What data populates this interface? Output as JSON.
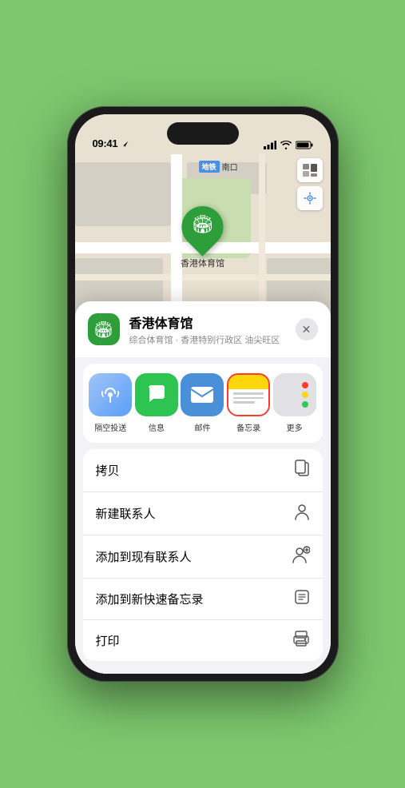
{
  "status_bar": {
    "time": "09:41",
    "location_arrow": true
  },
  "map": {
    "label_badge": "南口",
    "location_name": "香港体育馆",
    "pin_icon": "🏟"
  },
  "map_controls": {
    "map_icon": "🗺",
    "location_icon": "➤"
  },
  "location_card": {
    "name": "香港体育馆",
    "subtitle": "综合体育馆 · 香港特别行政区 油尖旺区",
    "close_label": "✕"
  },
  "share_items": [
    {
      "id": "airdrop",
      "label": "隔空投送",
      "type": "airdrop"
    },
    {
      "id": "messages",
      "label": "信息",
      "type": "messages"
    },
    {
      "id": "mail",
      "label": "邮件",
      "type": "mail"
    },
    {
      "id": "notes",
      "label": "备忘录",
      "type": "notes",
      "selected": true
    }
  ],
  "more_dots": [
    {
      "color": "#ff3b30"
    },
    {
      "color": "#ffd60a"
    },
    {
      "color": "#34c759"
    }
  ],
  "actions": [
    {
      "label": "拷贝",
      "icon": "copy"
    },
    {
      "label": "新建联系人",
      "icon": "person"
    },
    {
      "label": "添加到现有联系人",
      "icon": "person-add"
    },
    {
      "label": "添加到新快速备忘录",
      "icon": "note"
    },
    {
      "label": "打印",
      "icon": "print"
    }
  ]
}
